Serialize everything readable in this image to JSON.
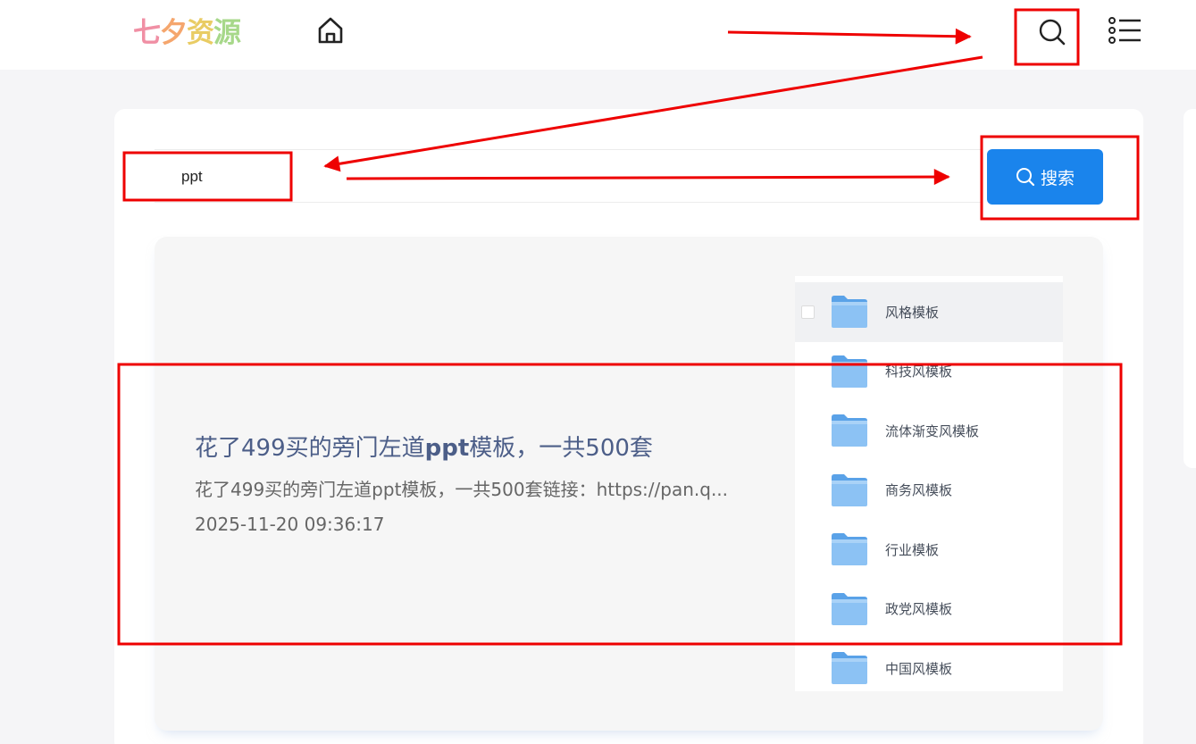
{
  "header": {
    "logo_chars": [
      {
        "ch": "七",
        "color": "#f08fa4"
      },
      {
        "ch": "夕",
        "color": "#f5a66d"
      },
      {
        "ch": "资",
        "color": "#e9cc64"
      },
      {
        "ch": "源",
        "color": "#a7d88a"
      }
    ],
    "home_icon": "home-icon",
    "search_icon": "search-icon",
    "menu_icon": "list-menu-icon"
  },
  "search": {
    "value": "ppt",
    "button_label": "搜索",
    "button_color": "#1a84ec"
  },
  "result": {
    "title_before": "花了499买的旁门左道",
    "title_highlight": "ppt",
    "title_after": "模板，一共500套",
    "snippet": "花了499买的旁门左道ppt模板，一共500套链接：https://pan.q...",
    "date": "2025-11-20 09:36:17",
    "thumbnail_folders": [
      "风格模板",
      "科技风模板",
      "流体渐变风模板",
      "商务风模板",
      "行业模板",
      "政党风模板",
      "中国风模板"
    ]
  },
  "annotation_color": "#ee0000"
}
